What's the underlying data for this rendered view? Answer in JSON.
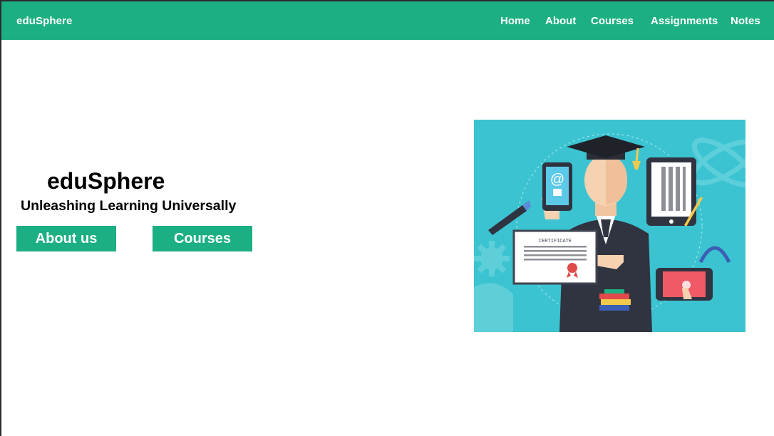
{
  "navbar": {
    "brand": "eduSphere",
    "links": [
      "Home",
      "About",
      "Courses",
      "Assignments",
      "Notes"
    ]
  },
  "hero": {
    "title": "eduSphere",
    "subtitle": "Unleashing Learning Universally",
    "buttons": [
      "About us",
      "Courses"
    ]
  },
  "illustration": {
    "certificate_label": "CERTIFICATE",
    "at_symbol": "@"
  },
  "colors": {
    "accent": "#1caf83",
    "illustration_bg": "#3bc3d1"
  }
}
